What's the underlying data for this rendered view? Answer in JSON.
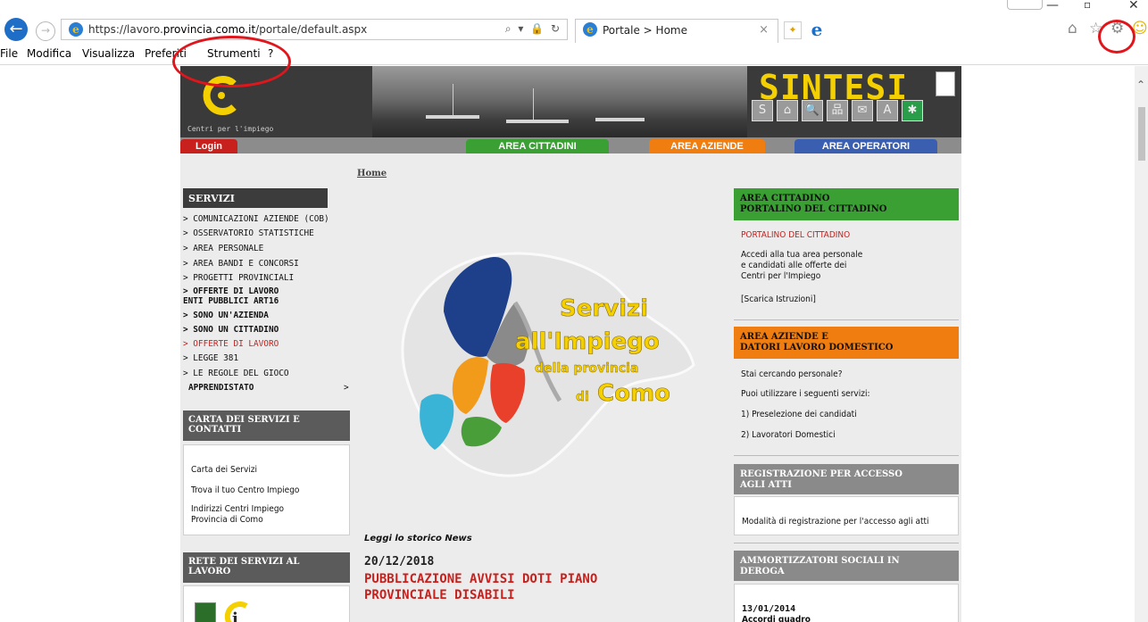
{
  "browser": {
    "url_prefix": "https://lavoro.",
    "url_domain": "provincia.como.it",
    "url_path": "/portale/default.aspx",
    "address_tools": "⌕ ▾ 🔒 ↻",
    "tab_title": "Portale > Home",
    "tab_close": "×",
    "menu": [
      "File",
      "Modifica",
      "Visualizza",
      "Preferiti",
      "Strumenti",
      "?"
    ]
  },
  "header": {
    "logo_caption": "Centri per l'impiego",
    "brand": "SINTESI",
    "login": "Login",
    "nav": [
      "AREA CITTADINI",
      "AREA AZIENDE",
      "AREA OPERATORI"
    ]
  },
  "breadcrumb": "Home",
  "left": {
    "servizi_title": "SERVIZI",
    "servizi": [
      "> COMUNICAZIONI AZIENDE (COB)",
      "> OSSERVATORIO STATISTICHE",
      "> AREA PERSONALE",
      "> AREA BANDI E CONCORSI",
      "> PROGETTI PROVINCIALI",
      "> OFFERTE DI LAVORO",
      "ENTI PUBBLICI ART16",
      "> SONO UN'AZIENDA",
      "> SONO UN CITTADINO",
      "> OFFERTE DI LAVORO",
      "> LEGGE 381",
      "> LE REGOLE DEL GIOCO",
      "APPRENDISTATO"
    ],
    "apprendistato_arrow": ">",
    "carta_title_1": "CARTA DEI SERVIZI E",
    "carta_title_2": "CONTATTI",
    "carta_links": [
      "Carta dei Servizi",
      "Trova il tuo Centro Impiego",
      "Indirizzi Centri Impiego",
      "Provincia di Como"
    ],
    "rete_title_1": "RETE DEI SERVIZI AL",
    "rete_title_2": "LAVORO"
  },
  "center": {
    "hero_line1": "Servizi",
    "hero_line2": "all'Impiego",
    "hero_line3": "della provincia",
    "hero_line4_small": "di",
    "hero_line4_big": "Como",
    "news_label": "Leggi lo storico News",
    "news_date": "20/12/2018",
    "news_title_1": "PUBBLICAZIONE AVVISI DOTI PIANO",
    "news_title_2": "PROVINCIALE DISABILI"
  },
  "right": {
    "cittadino_title_1": "AREA CITTADINO",
    "cittadino_title_2": "PORTALINO DEL CITTADINO",
    "cittadino_link": "PORTALINO DEL CITTADINO",
    "cittadino_text": [
      "Accedi alla tua area personale",
      "e candidati alle offerte dei",
      "Centri per l'Impiego"
    ],
    "istruzioni": "[Scarica Istruzioni]",
    "aziende_title_1": "AREA AZIENDE E",
    "aziende_title_2": "DATORI LAVORO DOMESTICO",
    "aziende_text": [
      "Stai cercando personale?",
      "Puoi utilizzare i seguenti servizi:",
      "1) Preselezione dei candidati",
      "2) Lavoratori Domestici"
    ],
    "registrazione_title_1": "REGISTRAZIONE PER ACCESSO",
    "registrazione_title_2": "AGLI ATTI",
    "registrazione_text": "Modalità di registrazione per l'accesso agli atti",
    "ammortizzatori_title_1": "AMMORTIZZATORI SOCIALI IN",
    "ammortizzatori_title_2": "DEROGA",
    "ammortizzatori_date": "13/01/2014",
    "ammortizzatori_text": "Accordi quadro"
  },
  "colors": {
    "green": "#3aa034",
    "orange": "#f07d10",
    "blue": "#3a5fb0",
    "red": "#c8201c",
    "yellow": "#f5d000"
  }
}
